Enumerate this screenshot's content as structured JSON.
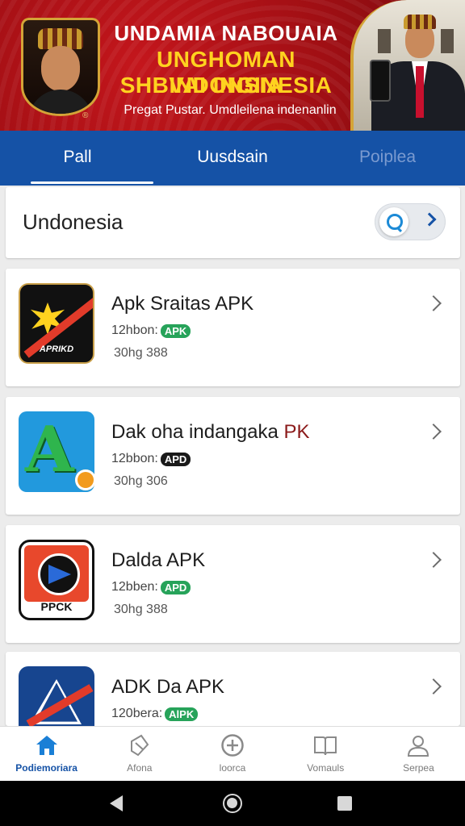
{
  "banner": {
    "line1": "UNDAMIA NABOUAIA",
    "line2": "UNGHOMAN INDONSIA",
    "line3": "SHBVAI INGINESIA",
    "subtitle": "Pregat Pustar. Umdleilena indenanlin",
    "crest_mark": "®"
  },
  "tabs": [
    {
      "label": "Pall",
      "active": true
    },
    {
      "label": "Uusdsain",
      "active": false
    },
    {
      "label": "Poiplea",
      "active": false
    }
  ],
  "search": {
    "value": "Undonesia"
  },
  "apps": [
    {
      "name": "Apk Sraitas APK",
      "name_accent": "",
      "meta": "12hbon:",
      "badge": "APK",
      "size": "30hg 388",
      "icon_label": "APRIKD",
      "icon": "apk-burst-icon"
    },
    {
      "name": "Dak oha indangaka ",
      "name_accent": "PK",
      "meta": "12bbon:",
      "badge": "APD",
      "size": "30hg 306",
      "icon_label": "",
      "icon": "green-a-icon"
    },
    {
      "name": "Dalda APK",
      "name_accent": "",
      "meta": "12bben:",
      "badge": "APD",
      "size": "30hg 388",
      "icon_label": "PPCK",
      "icon": "play-circle-icon"
    },
    {
      "name": "ADK Da APK",
      "name_accent": "",
      "meta": "120bera:",
      "badge": "AlPK",
      "size": "",
      "icon_label": "",
      "icon": "triangle-warning-icon"
    }
  ],
  "bottom_nav": [
    {
      "label": "Podiemoriara",
      "icon": "home-icon",
      "active": true
    },
    {
      "label": "Afona",
      "icon": "tag-icon",
      "active": false
    },
    {
      "label": "loorca",
      "icon": "add-circle-icon",
      "active": false
    },
    {
      "label": "Vomauls",
      "icon": "book-icon",
      "active": false
    },
    {
      "label": "Serpea",
      "icon": "profile-icon",
      "active": false
    }
  ],
  "colors": {
    "banner_red": "#c4161c",
    "banner_gold": "#ffd21f",
    "tab_blue": "#1552a6",
    "badge_green": "#27a35a",
    "active_nav": "#1552a6"
  }
}
